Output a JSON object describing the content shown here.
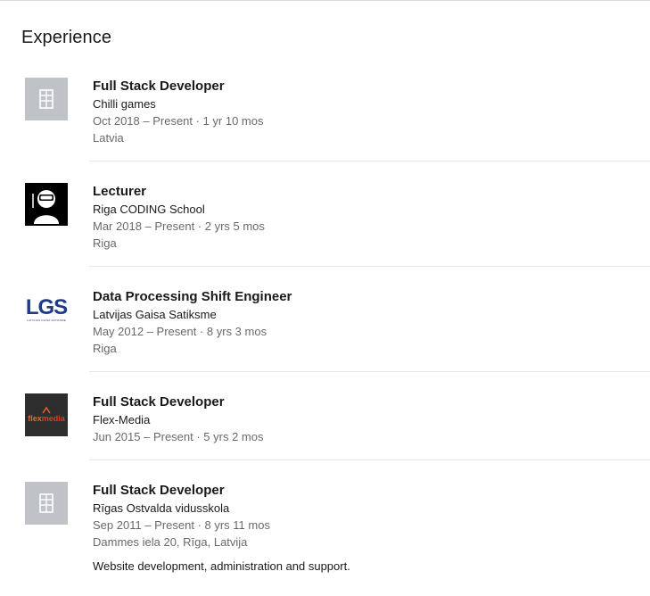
{
  "section": {
    "title": "Experience"
  },
  "experiences": [
    {
      "title": "Full Stack Developer",
      "company": "Chilli games",
      "dates": "Oct 2018 – Present · 1 yr 10 mos",
      "location": "Latvia",
      "logo_icon": "building-placeholder-icon"
    },
    {
      "title": "Lecturer",
      "company": "Riga CODING School",
      "dates": "Mar 2018 – Present · 2 yrs 5 mos",
      "location": "Riga",
      "logo_icon": "coding-school-logo"
    },
    {
      "title": "Data Processing Shift Engineer",
      "company": "Latvijas Gaisa Satiksme",
      "dates": "May 2012 – Present · 8 yrs 3 mos",
      "location": "Riga",
      "logo_icon": "lgs-logo",
      "logo_text": "LGS",
      "logo_subtext": "LATVIJAS GAISA SATIKSME"
    },
    {
      "title": "Full Stack Developer",
      "company": "Flex-Media",
      "dates": "Jun 2015 – Present · 5 yrs 2 mos",
      "logo_icon": "flex-media-logo",
      "logo_text_a": "flex",
      "logo_text_b": "media"
    },
    {
      "title": "Full Stack Developer",
      "company": "Rīgas Ostvalda vidusskola",
      "dates": "Sep 2011 – Present · 8 yrs 11 mos",
      "location": "Dammes iela 20, Rīga, Latvija",
      "description": "Website development, administration and support.",
      "logo_icon": "building-placeholder-icon"
    }
  ],
  "colors": {
    "ghost_logo_bg": "#bfc2c6",
    "lgs_blue": "#1f3a8a",
    "flex_orange": "#f26522",
    "flex_red": "#e03a2e"
  }
}
